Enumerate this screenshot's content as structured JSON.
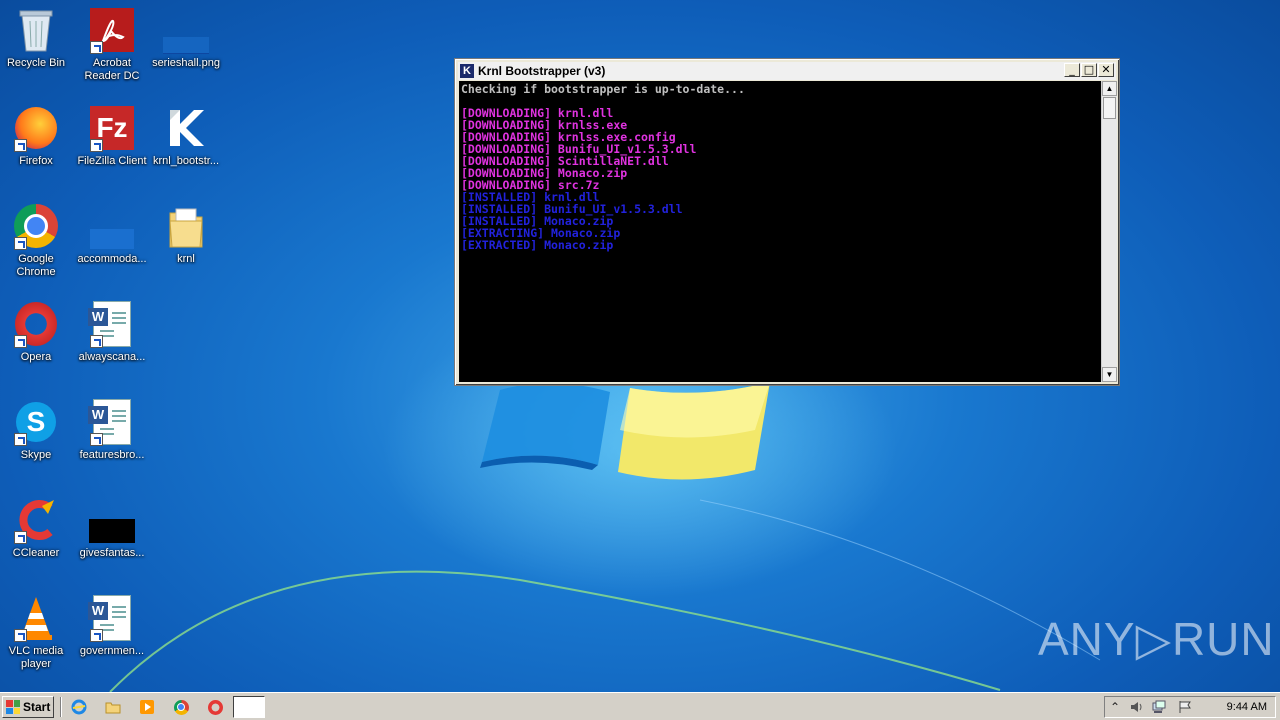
{
  "desktop": {
    "icons": [
      {
        "label": "Recycle Bin",
        "icon": "recycle-bin-icon"
      },
      {
        "label": "Acrobat Reader DC",
        "icon": "acrobat-reader-icon"
      },
      {
        "label": "serieshall.png",
        "icon": "image-file-icon"
      },
      {
        "label": "Firefox",
        "icon": "firefox-icon"
      },
      {
        "label": "FileZilla Client",
        "icon": "filezilla-icon"
      },
      {
        "label": "krnl_bootstr...",
        "icon": "krnl-app-icon"
      },
      {
        "label": "Google Chrome",
        "icon": "chrome-icon"
      },
      {
        "label": "accommoda...",
        "icon": "file-icon"
      },
      {
        "label": "krnl",
        "icon": "folder-icon"
      },
      {
        "label": "Opera",
        "icon": "opera-icon"
      },
      {
        "label": "alwayscana...",
        "icon": "word-document-icon"
      },
      {
        "label": "Skype",
        "icon": "skype-icon"
      },
      {
        "label": "featuresbro...",
        "icon": "word-document-icon"
      },
      {
        "label": "CCleaner",
        "icon": "ccleaner-icon"
      },
      {
        "label": "givesfantas...",
        "icon": "image-file-icon"
      },
      {
        "label": "VLC media player",
        "icon": "vlc-icon"
      },
      {
        "label": "governmen...",
        "icon": "word-document-icon"
      }
    ]
  },
  "window": {
    "title": "Krnl Bootstrapper (v3)",
    "app_icon_letter": "K",
    "minimize_glyph": "_",
    "maximize_glyph": "□",
    "close_glyph": "✕",
    "console_lines": [
      {
        "text": "Checking if bootstrapper is up-to-date...",
        "color": "#c0c0c0"
      },
      {
        "text": "",
        "color": "#c0c0c0"
      },
      {
        "text": "[DOWNLOADING] krnl.dll",
        "color": "#e033e0"
      },
      {
        "text": "[DOWNLOADING] krnlss.exe",
        "color": "#e033e0"
      },
      {
        "text": "[DOWNLOADING] krnlss.exe.config",
        "color": "#e033e0"
      },
      {
        "text": "[DOWNLOADING] Bunifu_UI_v1.5.3.dll",
        "color": "#e033e0"
      },
      {
        "text": "[DOWNLOADING] ScintillaNET.dll",
        "color": "#e033e0"
      },
      {
        "text": "[DOWNLOADING] Monaco.zip",
        "color": "#e033e0"
      },
      {
        "text": "[DOWNLOADING] src.7z",
        "color": "#e033e0"
      },
      {
        "text": "[INSTALLED] krnl.dll",
        "color": "#2222dd"
      },
      {
        "text": "[INSTALLED] Bunifu_UI_v1.5.3.dll",
        "color": "#2222dd"
      },
      {
        "text": "[INSTALLED] Monaco.zip",
        "color": "#2222dd"
      },
      {
        "text": "[EXTRACTING] Monaco.zip",
        "color": "#2222dd"
      },
      {
        "text": "[EXTRACTED] Monaco.zip",
        "color": "#2222dd"
      }
    ]
  },
  "taskbar": {
    "start_label": "Start",
    "quick_launch": [
      "internet-explorer-icon",
      "file-explorer-icon",
      "media-player-icon",
      "chrome-icon",
      "opera-icon"
    ],
    "tray": {
      "icons": [
        "show-hidden-icons-chevron",
        "volume-icon",
        "network-icon",
        "action-center-flag-icon"
      ],
      "clock": "9:44 AM"
    }
  },
  "watermark": "ANY▷RUN"
}
